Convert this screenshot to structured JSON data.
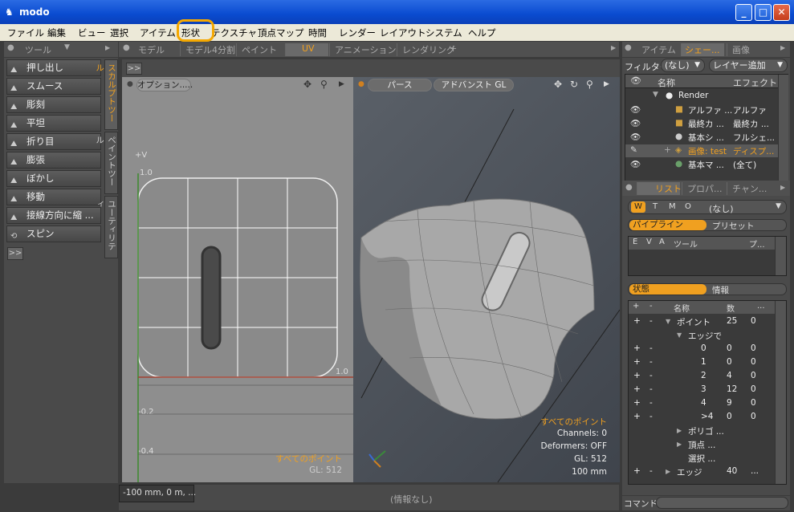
{
  "window": {
    "title": "modo"
  },
  "menu": [
    "ファイル",
    "編集",
    "ビュー",
    "選択",
    "アイテム",
    "形状",
    "テクスチャ",
    "頂点マップ",
    "時間",
    "レンダー",
    "レイアウト",
    "システム",
    "ヘルプ"
  ],
  "left_tabs": {
    "tools": "ツール"
  },
  "main_tabs": [
    "モデル",
    "モデル4分割",
    "ペイント",
    "UV",
    "アニメーション",
    "レンダリング",
    "+"
  ],
  "right_tabs": [
    "アイテム",
    "シェー...",
    "画像"
  ],
  "tools": [
    "押し出し",
    "スムース",
    "彫刻",
    "平坦",
    "折り目",
    "膨張",
    "ぼかし",
    "移動",
    "接線方向に縮 ...",
    "スピン"
  ],
  "vertical_tabs": [
    "スカルプトツール",
    "ペイントツール",
    "ユーティリティ"
  ],
  "collapse": ">>",
  "uv_view": {
    "options": "オプション.....",
    "axis_v": "+V",
    "labels": [
      "1.0",
      "1.0",
      "-0.2",
      "-0.4"
    ],
    "overlay1": "すべてのポイント",
    "overlay2": "GL: 512"
  },
  "persp_view": {
    "view_btn": "パース",
    "mode_btn": "アドバンスト GL",
    "overlay": [
      "すべてのポイント",
      "Channels: 0",
      "Deformers: OFF",
      "GL: 512",
      "100 mm"
    ]
  },
  "shader": {
    "filter_label": "フィルター",
    "filter_value": "(なし)",
    "add_layer": "レイヤー追加",
    "col_name": "名称",
    "col_effect": "エフェクト",
    "rows": [
      {
        "name": "Render",
        "effect": ""
      },
      {
        "name": "アルファ ...",
        "effect": "アルファ"
      },
      {
        "name": "最終カ ...",
        "effect": "最終カ ..."
      },
      {
        "name": "基本シ ...",
        "effect": "フルシェ..."
      },
      {
        "name": "画像: test",
        "effect": "ディスプ..."
      },
      {
        "name": "基本マ ...",
        "effect": "(全て)"
      }
    ]
  },
  "lower_tabs": [
    "リスト",
    "プロパ...",
    "チャン..."
  ],
  "list_filter": {
    "buttons": [
      "W",
      "T",
      "M",
      "O"
    ],
    "value": "(なし)"
  },
  "pipeline": {
    "tab1": "パイプライン",
    "tab2": "プリセット",
    "cols": [
      "E",
      "V",
      "A",
      "ツール",
      "プ..."
    ]
  },
  "info_tabs": {
    "tab1": "状態",
    "tab2": "情報"
  },
  "stats": {
    "cols": [
      "+",
      "-",
      "名称",
      "数",
      "..."
    ],
    "rows": [
      {
        "plus": "+",
        "minus": "-",
        "name": "ポイント",
        "n": "25",
        "v": "0",
        "indent": 1,
        "arrow": "▼"
      },
      {
        "plus": "",
        "minus": "",
        "name": "エッジで",
        "n": "",
        "v": "",
        "indent": 2,
        "arrow": "▼"
      },
      {
        "plus": "+",
        "minus": "-",
        "name": "0",
        "n": "0",
        "v": "0",
        "indent": 3,
        "arrow": ""
      },
      {
        "plus": "+",
        "minus": "-",
        "name": "1",
        "n": "0",
        "v": "0",
        "indent": 3,
        "arrow": ""
      },
      {
        "plus": "+",
        "minus": "-",
        "name": "2",
        "n": "4",
        "v": "0",
        "indent": 3,
        "arrow": ""
      },
      {
        "plus": "+",
        "minus": "-",
        "name": "3",
        "n": "12",
        "v": "0",
        "indent": 3,
        "arrow": ""
      },
      {
        "plus": "+",
        "minus": "-",
        "name": "4",
        "n": "9",
        "v": "0",
        "indent": 3,
        "arrow": ""
      },
      {
        "plus": "+",
        "minus": "-",
        "name": ">4",
        "n": "0",
        "v": "0",
        "indent": 3,
        "arrow": ""
      },
      {
        "plus": "",
        "minus": "",
        "name": "ポリゴ ...",
        "n": "",
        "v": "",
        "indent": 2,
        "arrow": "▶"
      },
      {
        "plus": "",
        "minus": "",
        "name": "頂点 ...",
        "n": "",
        "v": "",
        "indent": 2,
        "arrow": "▶"
      },
      {
        "plus": "",
        "minus": "",
        "name": "選択 ...",
        "n": "",
        "v": "",
        "indent": 2,
        "arrow": ""
      },
      {
        "plus": "+",
        "minus": "-",
        "name": "エッジ",
        "n": "40",
        "v": "...",
        "indent": 1,
        "arrow": "▶"
      }
    ]
  },
  "status": {
    "coords": "-100 mm, 0 m, ...",
    "info": "(情報なし)",
    "command_label": "コマンド"
  }
}
